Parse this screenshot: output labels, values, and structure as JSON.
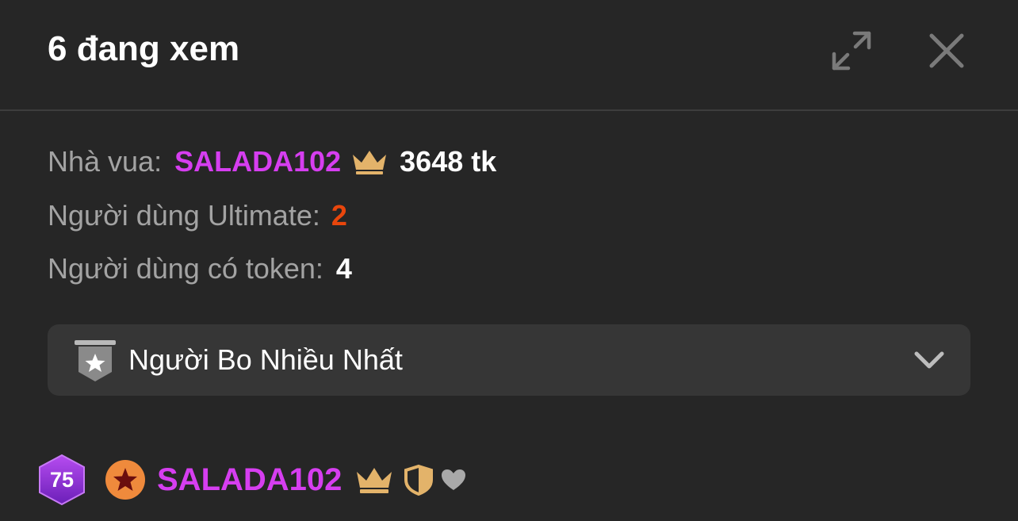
{
  "header": {
    "title": "6 đang xem",
    "expand_icon": "expand-icon",
    "close_icon": "close-icon"
  },
  "info": {
    "king_label": "Nhà vua:",
    "king_name": "SALADA102",
    "king_tokens": "3648 tk",
    "ultimate_label": "Người dùng Ultimate:",
    "ultimate_count": "2",
    "token_users_label": "Người dùng có token:",
    "token_users_count": "4"
  },
  "dropdown": {
    "selected": "Người Bo Nhiều Nhất",
    "icon": "star-shield-icon",
    "chevron": "chevron-down-icon"
  },
  "users": [
    {
      "level": "75",
      "name": "SALADA102",
      "badges": [
        "star-badge-icon",
        "crown-icon",
        "shield-icon",
        "heart-icon"
      ]
    }
  ],
  "colors": {
    "background": "#262626",
    "panel": "#363636",
    "king_name": "#d63ef0",
    "ultimate": "#e8460c",
    "crown": "#e3b36a",
    "level_badge": "#8e2fd6",
    "star_badge": "#ef8a3c"
  }
}
